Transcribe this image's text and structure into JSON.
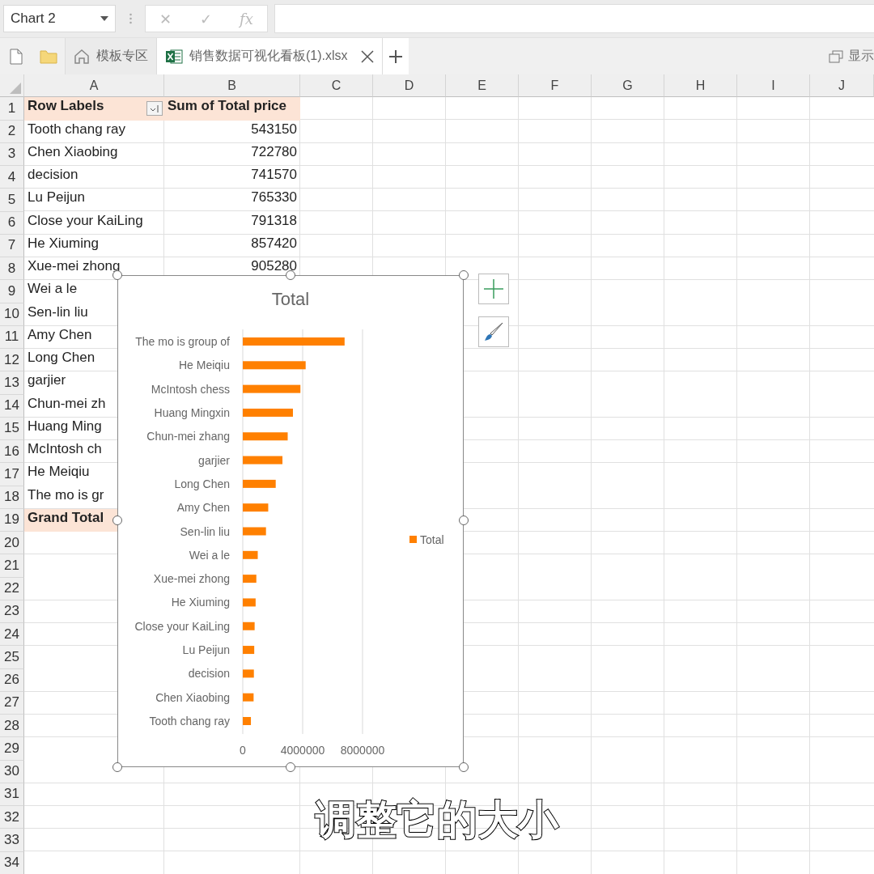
{
  "name_box": {
    "value": "Chart 2"
  },
  "formula_bar": {
    "cancel": "✕",
    "confirm": "✓",
    "function": "fx"
  },
  "tabs": [
    {
      "label": "模板专区",
      "kind": "home",
      "selected": false
    },
    {
      "label": "销售数据可视化看板(1).xlsx",
      "kind": "sheet",
      "selected": true
    }
  ],
  "tab_bar_right": {
    "label": "显示"
  },
  "sheet": {
    "columns": [
      "A",
      "B",
      "C",
      "D",
      "E",
      "F",
      "G",
      "H",
      "I",
      "J"
    ],
    "rows": [
      {
        "number": "1",
        "kind": "header",
        "cells": [
          "Row Labels",
          "Sum of Total price"
        ]
      },
      {
        "number": "2",
        "kind": "data",
        "cells": [
          "Tooth chang ray",
          "543150"
        ]
      },
      {
        "number": "3",
        "kind": "data",
        "cells": [
          "Chen Xiaobing",
          "722780"
        ]
      },
      {
        "number": "4",
        "kind": "data",
        "cells": [
          "decision",
          "741570"
        ]
      },
      {
        "number": "5",
        "kind": "data",
        "cells": [
          "Lu Peijun",
          "765330"
        ]
      },
      {
        "number": "6",
        "kind": "data",
        "cells": [
          "Close your KaiLing",
          "791318"
        ]
      },
      {
        "number": "7",
        "kind": "data",
        "cells": [
          "He Xiuming",
          "857420"
        ]
      },
      {
        "number": "8",
        "kind": "data",
        "cells": [
          "Xue-mei zhong",
          "905280"
        ]
      },
      {
        "number": "9",
        "kind": "data",
        "cells": [
          "Wei a le"
        ]
      },
      {
        "number": "10",
        "kind": "data",
        "cells": [
          "Sen-lin liu"
        ]
      },
      {
        "number": "11",
        "kind": "data",
        "cells": [
          "Amy Chen"
        ]
      },
      {
        "number": "12",
        "kind": "data",
        "cells": [
          "Long Chen"
        ]
      },
      {
        "number": "13",
        "kind": "data",
        "cells": [
          "garjier"
        ]
      },
      {
        "number": "14",
        "kind": "data",
        "cells": [
          "Chun-mei zh"
        ]
      },
      {
        "number": "15",
        "kind": "data",
        "cells": [
          "Huang Ming"
        ]
      },
      {
        "number": "16",
        "kind": "data",
        "cells": [
          "McIntosh ch"
        ]
      },
      {
        "number": "17",
        "kind": "data",
        "cells": [
          "He Meiqiu"
        ]
      },
      {
        "number": "18",
        "kind": "data",
        "cells": [
          "The mo is gr"
        ]
      },
      {
        "number": "19",
        "kind": "total",
        "cells": [
          "Grand Total"
        ]
      },
      {
        "number": "20"
      },
      {
        "number": "21"
      },
      {
        "number": "22"
      },
      {
        "number": "23"
      },
      {
        "number": "24"
      },
      {
        "number": "25"
      },
      {
        "number": "26"
      },
      {
        "number": "27"
      },
      {
        "number": "28"
      },
      {
        "number": "29"
      },
      {
        "number": "30"
      },
      {
        "number": "31"
      },
      {
        "number": "32"
      },
      {
        "number": "33"
      },
      {
        "number": "34"
      }
    ]
  },
  "chart": {
    "chart_data": {
      "type": "bar",
      "orientation": "horizontal",
      "title": "Total",
      "categories": [
        "The mo is group of",
        "He Meiqiu",
        "McIntosh chess",
        "Huang Mingxin",
        "Chun-mei zhang",
        "garjier",
        "Long Chen",
        "Amy Chen",
        "Sen-lin liu",
        "Wei a le",
        "Xue-mei zhong",
        "He Xiuming",
        "Close your KaiLing",
        "Lu Peijun",
        "decision",
        "Chen Xiaobing",
        "Tooth chang ray"
      ],
      "series": [
        {
          "name": "Total",
          "color": "#ff8000",
          "values": [
            6800000,
            4200000,
            3850000,
            3350000,
            3000000,
            2650000,
            2200000,
            1700000,
            1550000,
            1000000,
            905280,
            857420,
            791318,
            765330,
            741570,
            722780,
            543150
          ]
        }
      ],
      "xlim": [
        0,
        8000000
      ],
      "xticks": [
        0,
        4000000,
        8000000
      ]
    }
  },
  "subtitle": "调整它的大小"
}
